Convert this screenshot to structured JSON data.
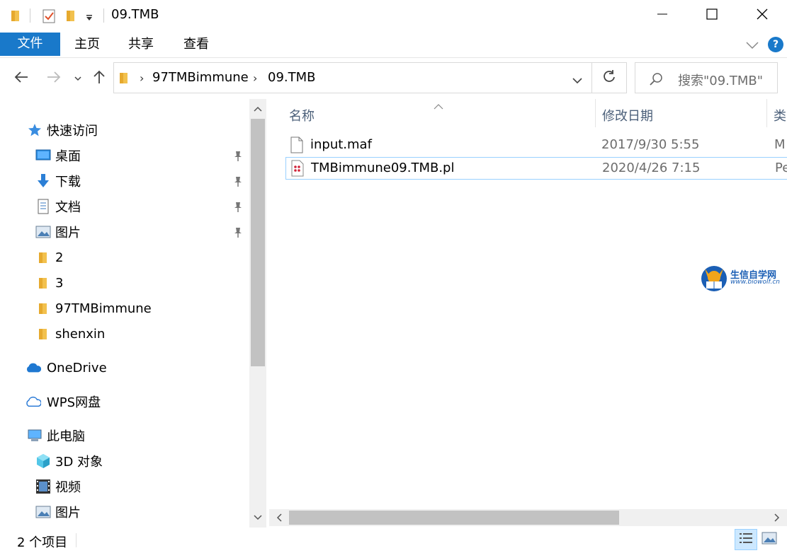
{
  "window": {
    "title": "09.TMB",
    "minimize_icon": "minimize-icon",
    "maximize_icon": "maximize-icon",
    "close_icon": "close-icon"
  },
  "ribbon": {
    "tabs": [
      {
        "label": "文件",
        "active": true
      },
      {
        "label": "主页"
      },
      {
        "label": "共享"
      },
      {
        "label": "查看"
      }
    ],
    "help_label": "?"
  },
  "address": {
    "segments": [
      "97TMBimmune",
      "09.TMB"
    ],
    "search_placeholder": "搜索\"09.TMB\""
  },
  "navpane": {
    "quick_access": {
      "label": "快速访问",
      "items": [
        {
          "label": "桌面",
          "icon": "desktop-icon",
          "pinned": true
        },
        {
          "label": "下载",
          "icon": "download-icon",
          "pinned": true
        },
        {
          "label": "文档",
          "icon": "documents-icon",
          "pinned": true
        },
        {
          "label": "图片",
          "icon": "pictures-icon",
          "pinned": true
        },
        {
          "label": "2",
          "icon": "folder-icon"
        },
        {
          "label": "3",
          "icon": "folder-icon"
        },
        {
          "label": "97TMBimmune",
          "icon": "folder-icon"
        },
        {
          "label": "shenxin",
          "icon": "folder-icon"
        }
      ]
    },
    "onedrive": "OneDrive",
    "wps": "WPS网盘",
    "this_pc": {
      "label": "此电脑",
      "items": [
        {
          "label": "3D 对象",
          "icon": "3d-objects-icon"
        },
        {
          "label": "视频",
          "icon": "videos-icon"
        },
        {
          "label": "图片",
          "icon": "pictures-icon"
        }
      ]
    }
  },
  "filelist": {
    "columns": [
      "名称",
      "修改日期",
      "类"
    ],
    "rows": [
      {
        "name": "input.maf",
        "date": "2017/9/30 5:55",
        "type": "M",
        "icon": "file-icon"
      },
      {
        "name": "TMBimmune09.TMB.pl",
        "date": "2020/4/26 7:15",
        "type": "Pe",
        "icon": "perl-file-icon"
      }
    ]
  },
  "watermark": {
    "title": "生信自学网",
    "url": "www.biowolf.cn"
  },
  "status": {
    "count": "2 个项目"
  },
  "colors": {
    "accent": "#1979ca",
    "selection": "#cce8ff",
    "folder": "#f2c14e"
  }
}
